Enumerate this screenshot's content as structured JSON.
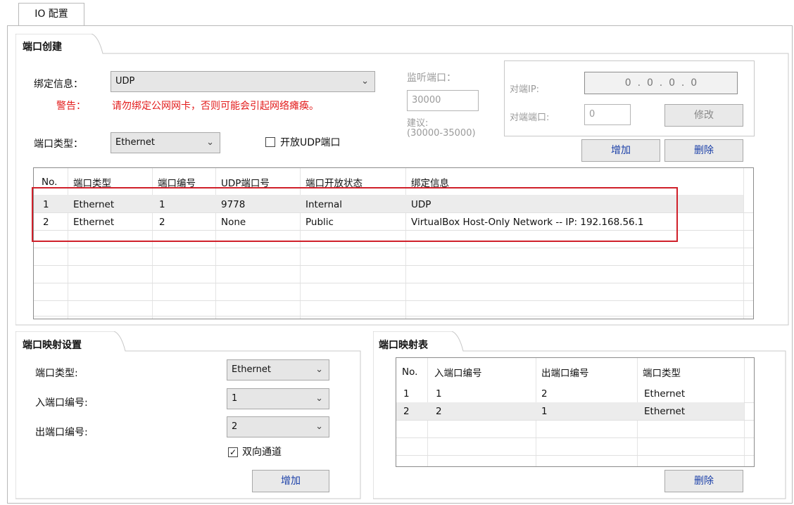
{
  "tab": {
    "label": "IO 配置"
  },
  "port_create": {
    "title": "端口创建",
    "bind_label": "绑定信息：",
    "bind_value": "UDP",
    "warning_label": "警告：",
    "warning_text": "请勿绑定公网网卡，否则可能会引起网络瘫痪。",
    "port_type_label": "端口类型：",
    "port_type_value": "Ethernet",
    "open_udp_label": "开放UDP端口",
    "listen_port_label": "监听端口：",
    "listen_port_value": "30000",
    "suggest_label": "建议:",
    "suggest_range": "(30000-35000)",
    "peer_ip_label": "对端IP:",
    "peer_ip_value": "0  .  0  .  0  .  0",
    "peer_port_label": "对端端口:",
    "peer_port_value": "0",
    "modify_button": "修改",
    "add_button": "增加",
    "delete_button": "删除",
    "table": {
      "headers": [
        "No.",
        "端口类型",
        "端口编号",
        "UDP端口号",
        "端口开放状态",
        "绑定信息"
      ],
      "rows": [
        [
          "1",
          "Ethernet",
          "1",
          "9778",
          "Internal",
          "UDP"
        ],
        [
          "2",
          "Ethernet",
          "2",
          "None",
          "Public",
          "VirtualBox Host-Only Network -- IP: 192.168.56.1"
        ]
      ]
    }
  },
  "mapping_settings": {
    "title": "端口映射设置",
    "port_type_label": "端口类型:",
    "port_type_value": "Ethernet",
    "in_port_label": "入端口编号:",
    "in_port_value": "1",
    "out_port_label": "出端口编号:",
    "out_port_value": "2",
    "bidirectional_label": "双向通道",
    "bidirectional_checked": true,
    "add_button": "增加"
  },
  "mapping_table": {
    "title": "端口映射表",
    "headers": [
      "No.",
      "入端口编号",
      "出端口编号",
      "端口类型"
    ],
    "rows": [
      [
        "1",
        "1",
        "2",
        "Ethernet"
      ],
      [
        "2",
        "2",
        "1",
        "Ethernet"
      ]
    ],
    "delete_button": "删除"
  },
  "colors": {
    "accent_blue": "#1a3fa8",
    "warning_red": "#e31c1c",
    "highlight_box": "#d0202a"
  }
}
